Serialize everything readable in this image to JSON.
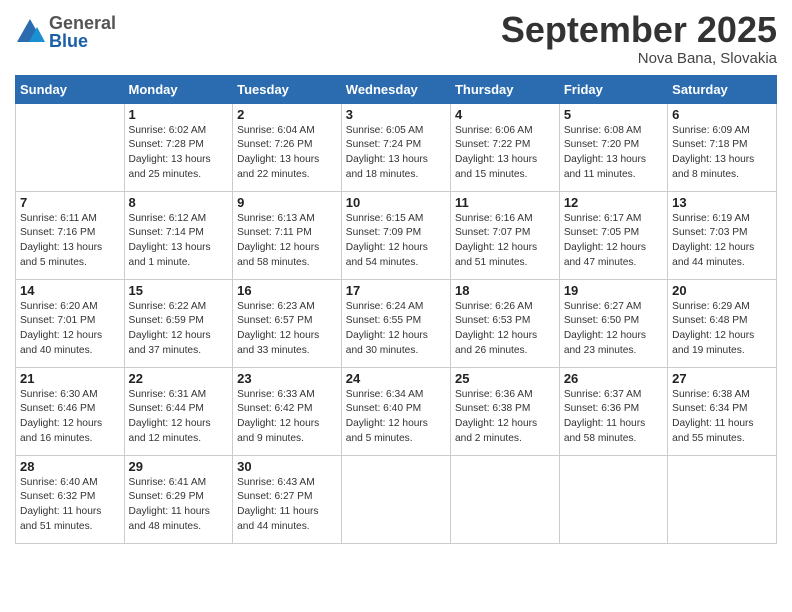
{
  "header": {
    "logo_general": "General",
    "logo_blue": "Blue",
    "month_title": "September 2025",
    "location": "Nova Bana, Slovakia"
  },
  "weekdays": [
    "Sunday",
    "Monday",
    "Tuesday",
    "Wednesday",
    "Thursday",
    "Friday",
    "Saturday"
  ],
  "weeks": [
    [
      {
        "day": "",
        "info": ""
      },
      {
        "day": "1",
        "info": "Sunrise: 6:02 AM\nSunset: 7:28 PM\nDaylight: 13 hours\nand 25 minutes."
      },
      {
        "day": "2",
        "info": "Sunrise: 6:04 AM\nSunset: 7:26 PM\nDaylight: 13 hours\nand 22 minutes."
      },
      {
        "day": "3",
        "info": "Sunrise: 6:05 AM\nSunset: 7:24 PM\nDaylight: 13 hours\nand 18 minutes."
      },
      {
        "day": "4",
        "info": "Sunrise: 6:06 AM\nSunset: 7:22 PM\nDaylight: 13 hours\nand 15 minutes."
      },
      {
        "day": "5",
        "info": "Sunrise: 6:08 AM\nSunset: 7:20 PM\nDaylight: 13 hours\nand 11 minutes."
      },
      {
        "day": "6",
        "info": "Sunrise: 6:09 AM\nSunset: 7:18 PM\nDaylight: 13 hours\nand 8 minutes."
      }
    ],
    [
      {
        "day": "7",
        "info": "Sunrise: 6:11 AM\nSunset: 7:16 PM\nDaylight: 13 hours\nand 5 minutes."
      },
      {
        "day": "8",
        "info": "Sunrise: 6:12 AM\nSunset: 7:14 PM\nDaylight: 13 hours\nand 1 minute."
      },
      {
        "day": "9",
        "info": "Sunrise: 6:13 AM\nSunset: 7:11 PM\nDaylight: 12 hours\nand 58 minutes."
      },
      {
        "day": "10",
        "info": "Sunrise: 6:15 AM\nSunset: 7:09 PM\nDaylight: 12 hours\nand 54 minutes."
      },
      {
        "day": "11",
        "info": "Sunrise: 6:16 AM\nSunset: 7:07 PM\nDaylight: 12 hours\nand 51 minutes."
      },
      {
        "day": "12",
        "info": "Sunrise: 6:17 AM\nSunset: 7:05 PM\nDaylight: 12 hours\nand 47 minutes."
      },
      {
        "day": "13",
        "info": "Sunrise: 6:19 AM\nSunset: 7:03 PM\nDaylight: 12 hours\nand 44 minutes."
      }
    ],
    [
      {
        "day": "14",
        "info": "Sunrise: 6:20 AM\nSunset: 7:01 PM\nDaylight: 12 hours\nand 40 minutes."
      },
      {
        "day": "15",
        "info": "Sunrise: 6:22 AM\nSunset: 6:59 PM\nDaylight: 12 hours\nand 37 minutes."
      },
      {
        "day": "16",
        "info": "Sunrise: 6:23 AM\nSunset: 6:57 PM\nDaylight: 12 hours\nand 33 minutes."
      },
      {
        "day": "17",
        "info": "Sunrise: 6:24 AM\nSunset: 6:55 PM\nDaylight: 12 hours\nand 30 minutes."
      },
      {
        "day": "18",
        "info": "Sunrise: 6:26 AM\nSunset: 6:53 PM\nDaylight: 12 hours\nand 26 minutes."
      },
      {
        "day": "19",
        "info": "Sunrise: 6:27 AM\nSunset: 6:50 PM\nDaylight: 12 hours\nand 23 minutes."
      },
      {
        "day": "20",
        "info": "Sunrise: 6:29 AM\nSunset: 6:48 PM\nDaylight: 12 hours\nand 19 minutes."
      }
    ],
    [
      {
        "day": "21",
        "info": "Sunrise: 6:30 AM\nSunset: 6:46 PM\nDaylight: 12 hours\nand 16 minutes."
      },
      {
        "day": "22",
        "info": "Sunrise: 6:31 AM\nSunset: 6:44 PM\nDaylight: 12 hours\nand 12 minutes."
      },
      {
        "day": "23",
        "info": "Sunrise: 6:33 AM\nSunset: 6:42 PM\nDaylight: 12 hours\nand 9 minutes."
      },
      {
        "day": "24",
        "info": "Sunrise: 6:34 AM\nSunset: 6:40 PM\nDaylight: 12 hours\nand 5 minutes."
      },
      {
        "day": "25",
        "info": "Sunrise: 6:36 AM\nSunset: 6:38 PM\nDaylight: 12 hours\nand 2 minutes."
      },
      {
        "day": "26",
        "info": "Sunrise: 6:37 AM\nSunset: 6:36 PM\nDaylight: 11 hours\nand 58 minutes."
      },
      {
        "day": "27",
        "info": "Sunrise: 6:38 AM\nSunset: 6:34 PM\nDaylight: 11 hours\nand 55 minutes."
      }
    ],
    [
      {
        "day": "28",
        "info": "Sunrise: 6:40 AM\nSunset: 6:32 PM\nDaylight: 11 hours\nand 51 minutes."
      },
      {
        "day": "29",
        "info": "Sunrise: 6:41 AM\nSunset: 6:29 PM\nDaylight: 11 hours\nand 48 minutes."
      },
      {
        "day": "30",
        "info": "Sunrise: 6:43 AM\nSunset: 6:27 PM\nDaylight: 11 hours\nand 44 minutes."
      },
      {
        "day": "",
        "info": ""
      },
      {
        "day": "",
        "info": ""
      },
      {
        "day": "",
        "info": ""
      },
      {
        "day": "",
        "info": ""
      }
    ]
  ]
}
